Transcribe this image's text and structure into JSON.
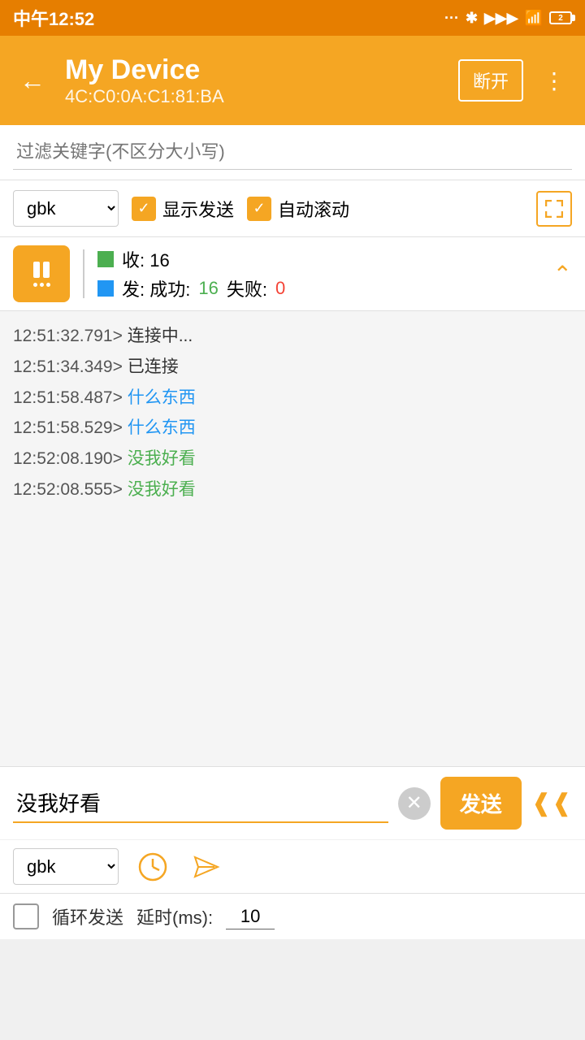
{
  "statusBar": {
    "time": "中午12:52",
    "battery": "2"
  },
  "topBar": {
    "deviceName": "My Device",
    "deviceMac": "4C:C0:0A:C1:81:BA",
    "disconnectLabel": "断开",
    "moreLabel": "⋮"
  },
  "filter": {
    "placeholder": "过滤关键字(不区分大小写)"
  },
  "controls": {
    "encoding": "gbk",
    "showSendLabel": "显示发送",
    "autoScrollLabel": "自动滚动"
  },
  "stats": {
    "recvLabel": "收: 16",
    "sendLabel": "发: 成功: ",
    "sendSuccess": "16",
    "sendFailLabel": " 失败: ",
    "sendFail": "0"
  },
  "logs": [
    {
      "time": "12:51:32.791>",
      "text": " 连接中...",
      "color": "default"
    },
    {
      "time": "12:51:34.349>",
      "text": " 已连接",
      "color": "default"
    },
    {
      "time": "12:51:58.487>",
      "text": " 什么东西",
      "color": "blue"
    },
    {
      "time": "12:51:58.529>",
      "text": " 什么东西",
      "color": "blue"
    },
    {
      "time": "12:52:08.190>",
      "text": " 没我好看",
      "color": "green"
    },
    {
      "time": "12:52:08.555>",
      "text": " 没我好看",
      "color": "green"
    }
  ],
  "bottomInput": {
    "value": "没我好看",
    "sendLabel": "发送"
  },
  "bottomControls": {
    "encoding": "gbk"
  },
  "loopRow": {
    "label": "循环发送",
    "delayLabel": "延时(ms):",
    "delayValue": "10"
  }
}
